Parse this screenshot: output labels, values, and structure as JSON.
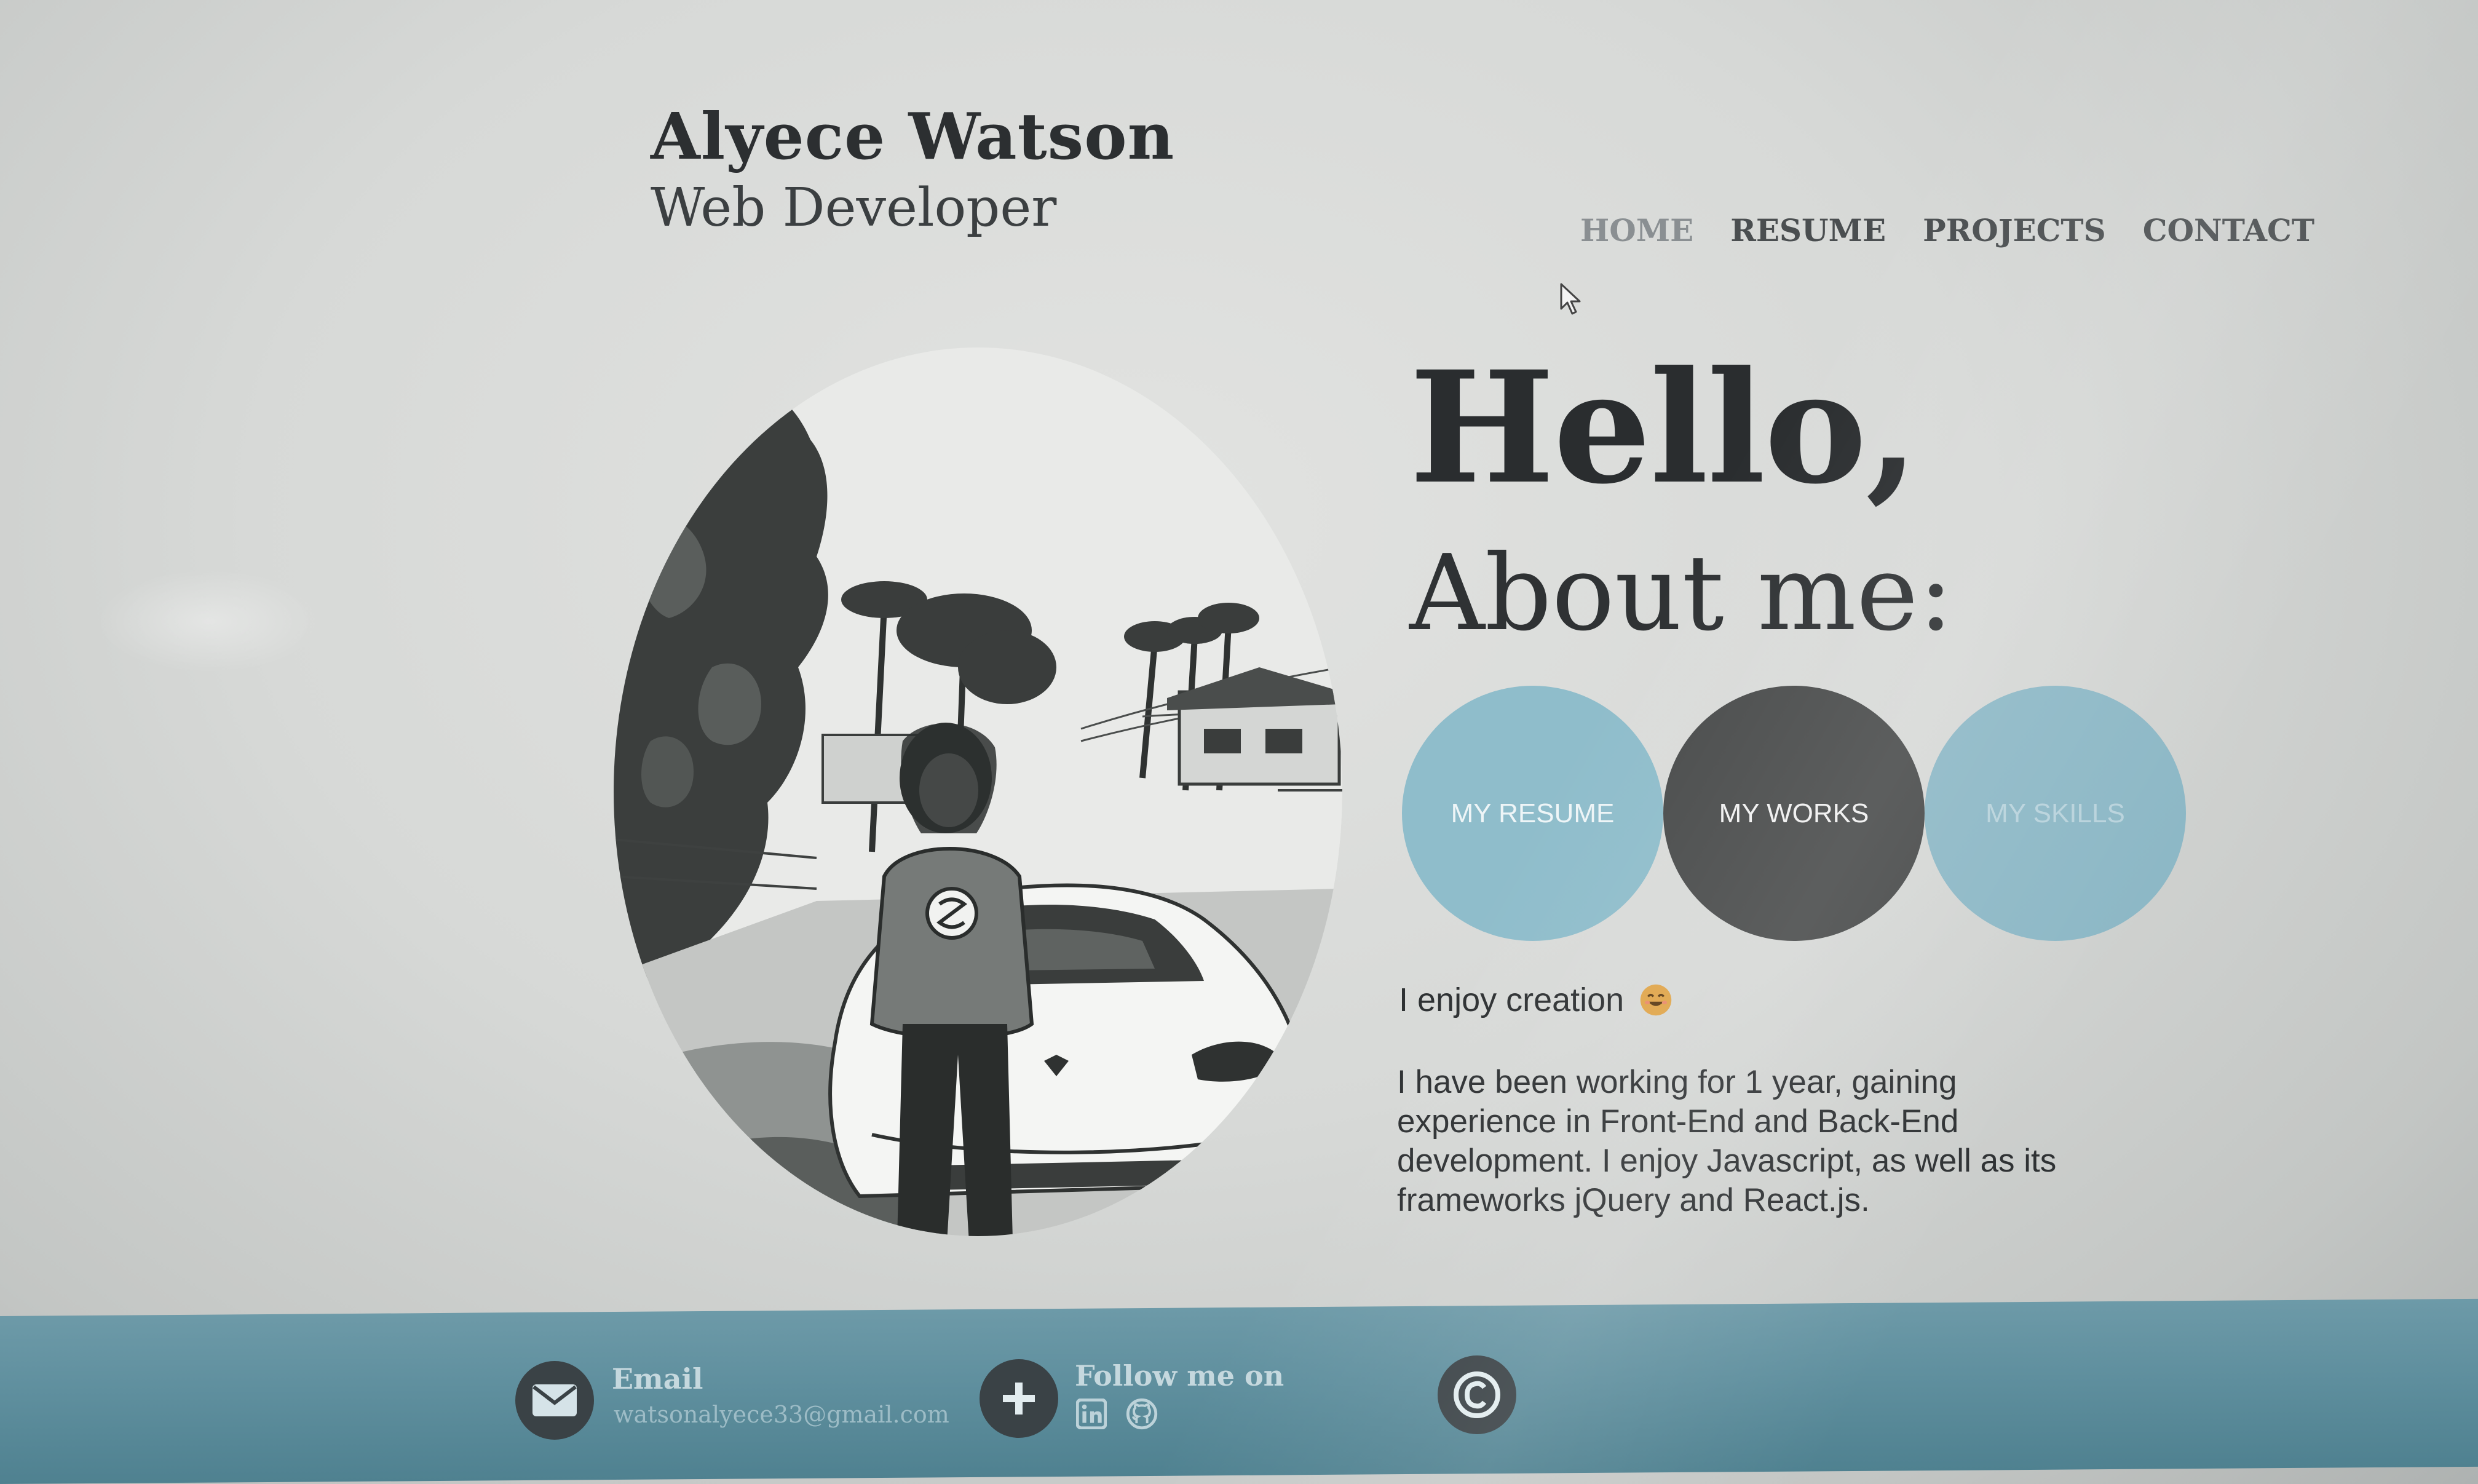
{
  "header": {
    "name": "Alyece Watson",
    "role": "Web Developer"
  },
  "nav": {
    "items": [
      {
        "label": "HOME",
        "active": true
      },
      {
        "label": "RESUME",
        "active": false
      },
      {
        "label": "PROJECTS",
        "active": false
      },
      {
        "label": "CONTACT",
        "active": false
      }
    ]
  },
  "hero": {
    "greeting": "Hello,",
    "heading": "About me:",
    "buttons": [
      {
        "label": "MY RESUME",
        "color": "#8fbdcb"
      },
      {
        "label": "MY WORKS",
        "color": "#4a4c4c"
      },
      {
        "label": "MY SKILLS",
        "color": "#8db8c6"
      }
    ],
    "tagline": "I enjoy creation",
    "tagline_icon": "smiling-face-icon",
    "bio": "I have been working for 1 year, gaining experience in Front-End and Back-End development. I enjoy Javascript, as well as its frameworks jQuery and React.js."
  },
  "photo": {
    "icon": "profile-photo"
  },
  "footer": {
    "email_label": "Email",
    "email_value": "watsonalyece33@gmail.com",
    "follow_label": "Follow me on",
    "social_icons": [
      "linkedin-icon",
      "github-icon"
    ],
    "copyright_icon": "copyright-icon",
    "color": "#5f8f9e"
  }
}
